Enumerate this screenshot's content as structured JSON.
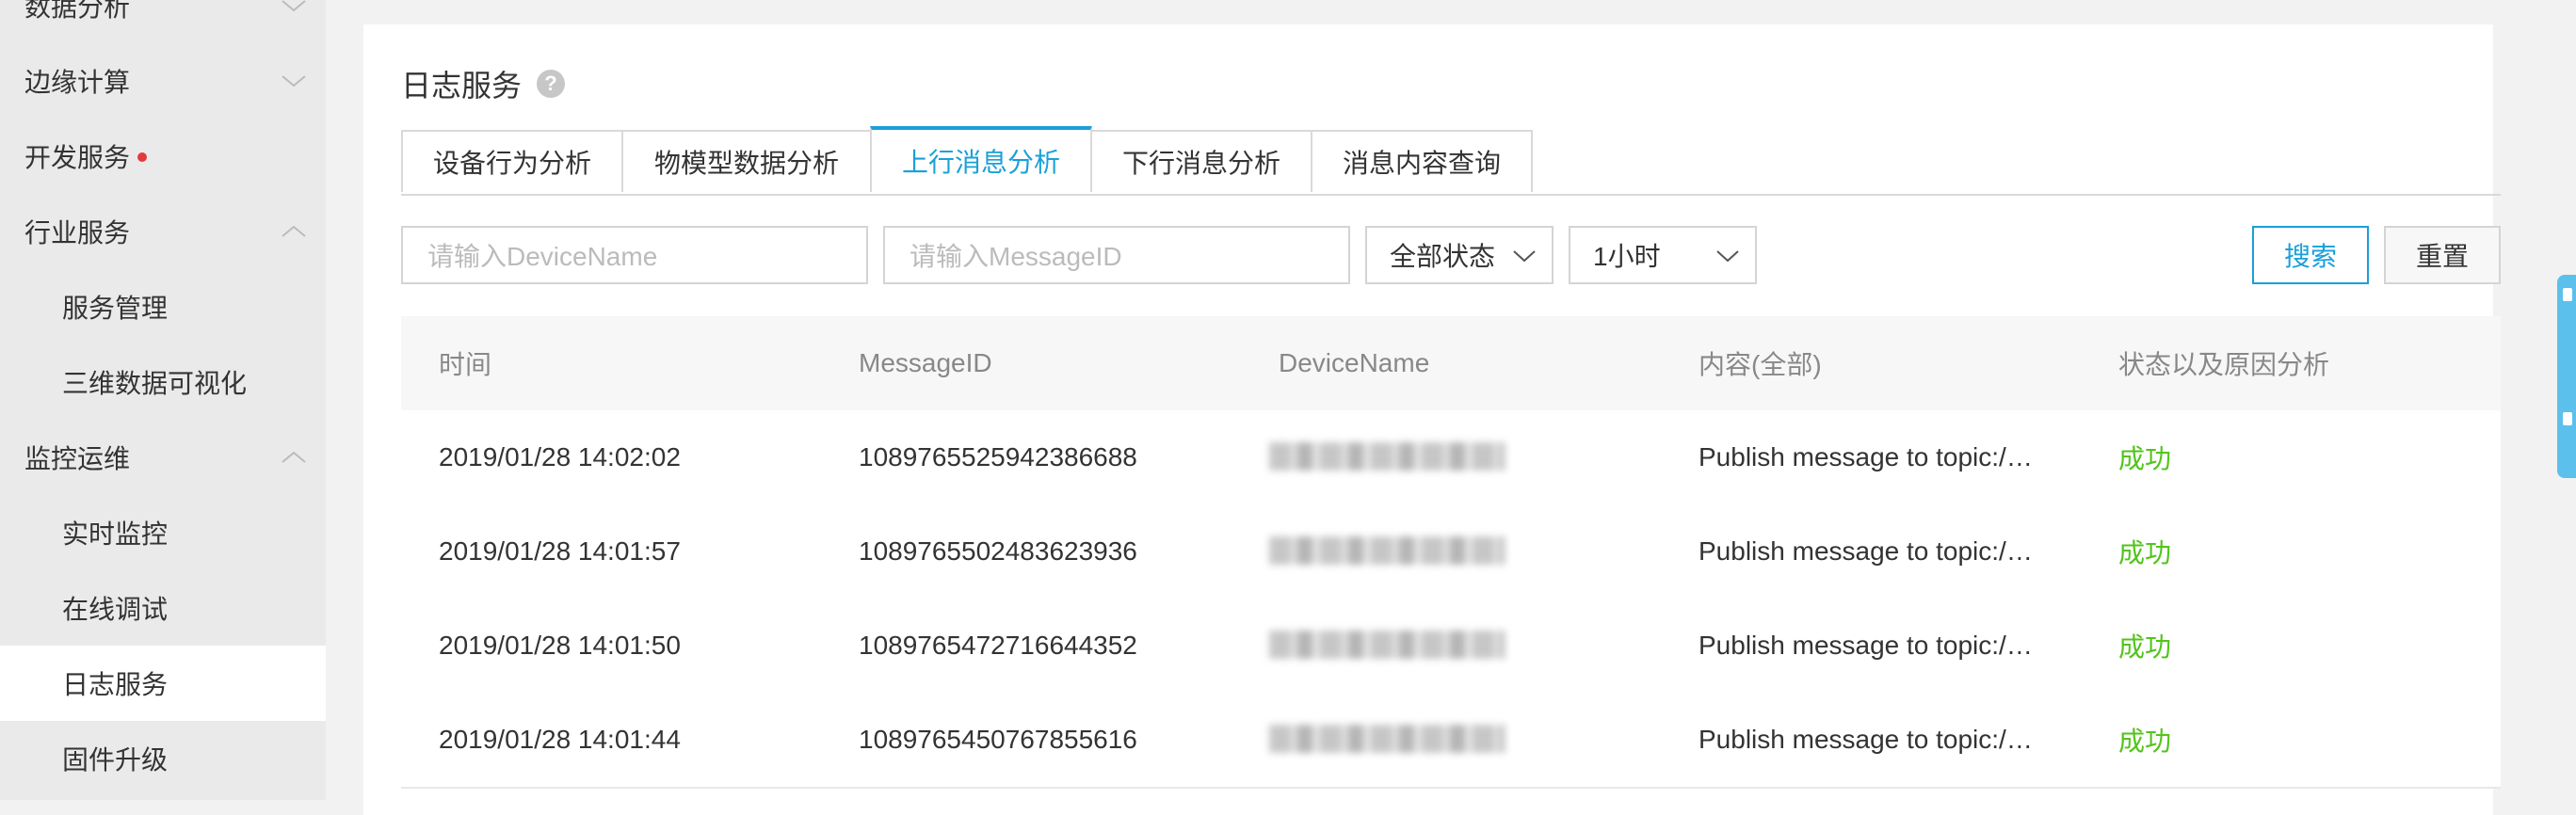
{
  "sidebar": {
    "items": [
      {
        "label": "数据分析",
        "level": 1,
        "chevron": "down"
      },
      {
        "label": "边缘计算",
        "level": 1,
        "chevron": "down"
      },
      {
        "label": "开发服务",
        "level": 1,
        "badge_dot": true
      },
      {
        "label": "行业服务",
        "level": 1,
        "chevron": "up"
      },
      {
        "label": "服务管理",
        "level": 2
      },
      {
        "label": "三维数据可视化",
        "level": 2
      },
      {
        "label": "监控运维",
        "level": 1,
        "chevron": "up"
      },
      {
        "label": "实时监控",
        "level": 2
      },
      {
        "label": "在线调试",
        "level": 2
      },
      {
        "label": "日志服务",
        "level": 2,
        "active": true
      },
      {
        "label": "固件升级",
        "level": 2
      }
    ]
  },
  "page": {
    "title": "日志服务",
    "help_icon": "?"
  },
  "tabs": [
    {
      "label": "设备行为分析"
    },
    {
      "label": "物模型数据分析"
    },
    {
      "label": "上行消息分析",
      "active": true
    },
    {
      "label": "下行消息分析"
    },
    {
      "label": "消息内容查询"
    }
  ],
  "filters": {
    "device_placeholder": "请输入DeviceName",
    "message_placeholder": "请输入MessageID",
    "status_select": "全部状态",
    "time_select": "1小时",
    "search_label": "搜索",
    "reset_label": "重置"
  },
  "table": {
    "columns": [
      "时间",
      "MessageID",
      "DeviceName",
      "内容(全部)",
      "状态以及原因分析"
    ],
    "rows": [
      {
        "time": "2019/01/28 14:02:02",
        "message_id": "1089765525942386688",
        "device_name": "",
        "content": "Publish message to topic:/…",
        "status": "成功"
      },
      {
        "time": "2019/01/28 14:01:57",
        "message_id": "1089765502483623936",
        "device_name": "",
        "content": "Publish message to topic:/…",
        "status": "成功"
      },
      {
        "time": "2019/01/28 14:01:50",
        "message_id": "1089765472716644352",
        "device_name": "",
        "content": "Publish message to topic:/…",
        "status": "成功"
      },
      {
        "time": "2019/01/28 14:01:44",
        "message_id": "1089765450767855616",
        "device_name": "",
        "content": "Publish message to topic:/…",
        "status": "成功"
      }
    ]
  },
  "colors": {
    "accent": "#1aa0d9",
    "success": "#52c41a",
    "badge": "#e4393c"
  }
}
